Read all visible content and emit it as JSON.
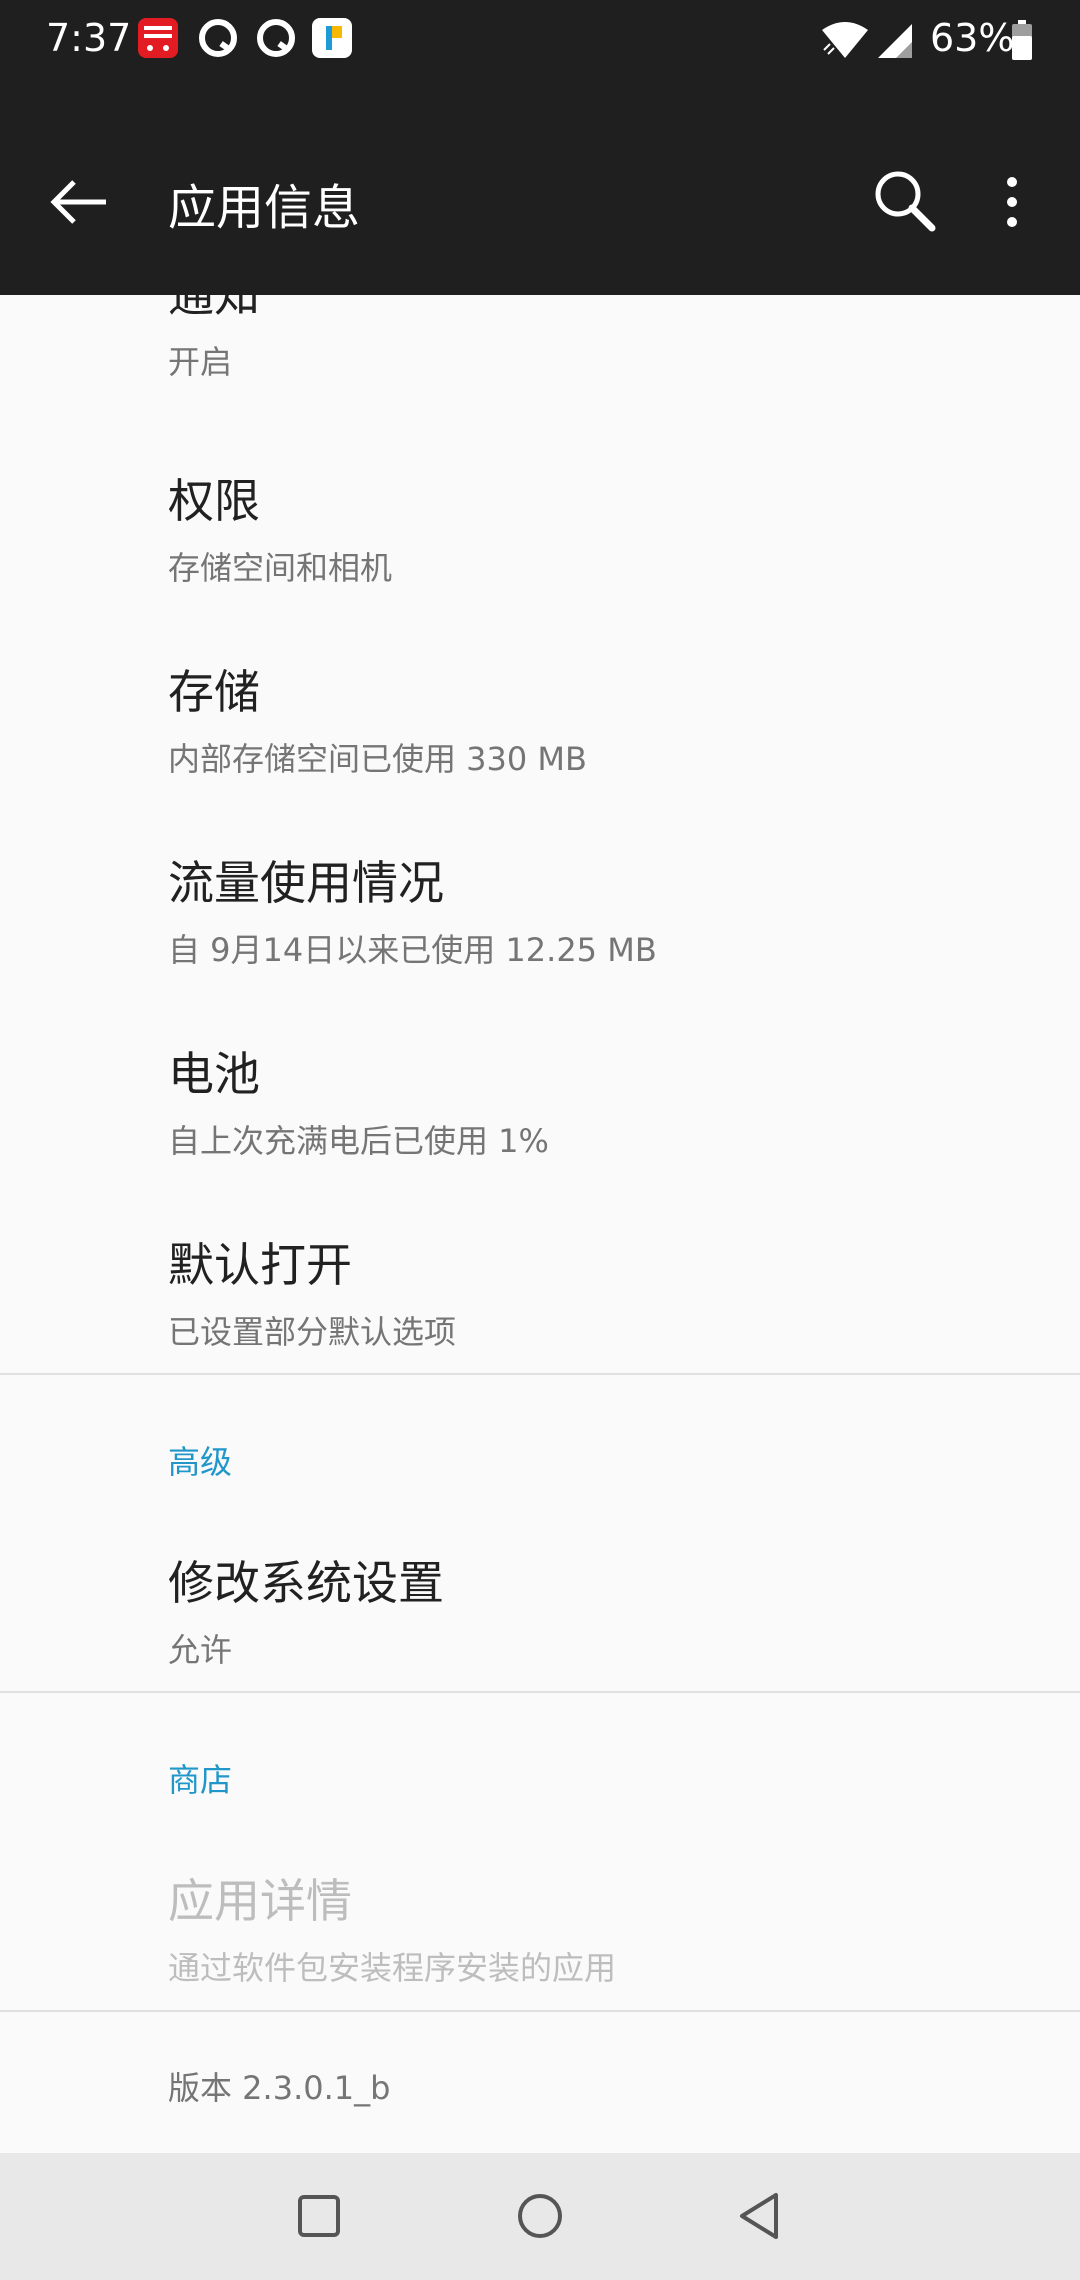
{
  "status_bar": {
    "time": "7:37",
    "battery": "63%",
    "notification_icons": [
      "tmall-icon",
      "qq-icon",
      "qq-icon",
      "pp-assistant-icon"
    ]
  },
  "app_bar": {
    "title": "应用信息"
  },
  "items": [
    {
      "title": "通知",
      "summary": "开启"
    },
    {
      "title": "权限",
      "summary": "存储空间和相机"
    },
    {
      "title": "存储",
      "summary": "内部存储空间已使用 330 MB"
    },
    {
      "title": "流量使用情况",
      "summary": "自 9月14日以来已使用 12.25 MB"
    },
    {
      "title": "电池",
      "summary": "自上次充满电后已使用 1%"
    },
    {
      "title": "默认打开",
      "summary": "已设置部分默认选项"
    }
  ],
  "advanced": {
    "header": "高级",
    "items": [
      {
        "title": "修改系统设置",
        "summary": "允许"
      }
    ]
  },
  "store": {
    "header": "商店",
    "items": [
      {
        "title": "应用详情",
        "summary": "通过软件包安装程序安装的应用"
      }
    ]
  },
  "version": "版本 2.3.0.1_b",
  "colors": {
    "app_bar": "#1f1f1f",
    "accent": "#2196c9",
    "background": "#fafafa"
  }
}
